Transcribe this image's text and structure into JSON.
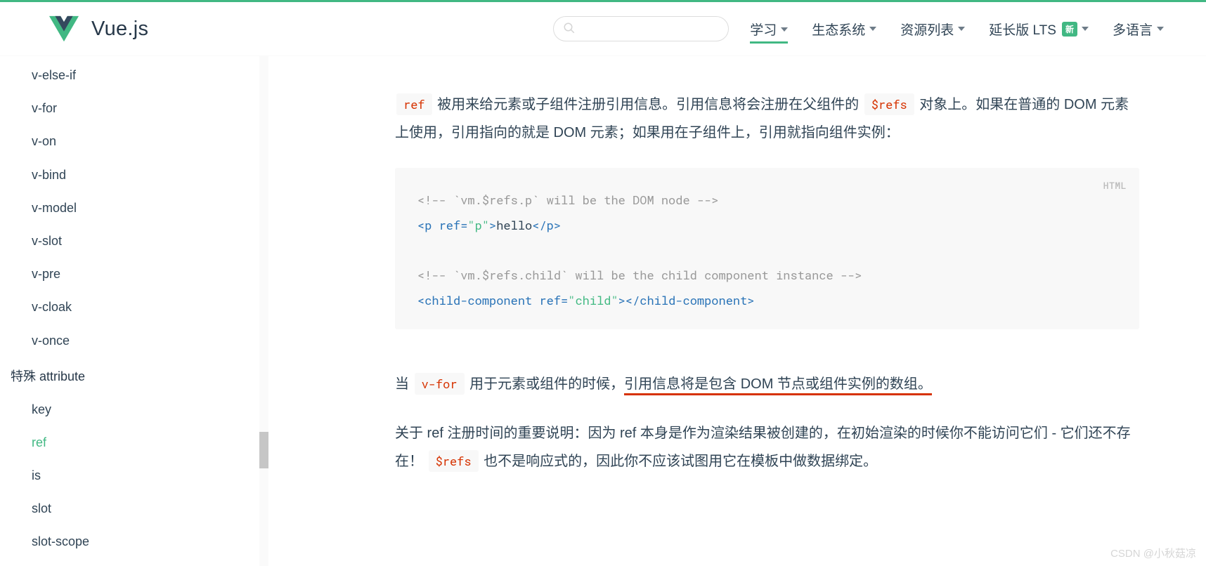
{
  "header": {
    "brand": "Vue.js",
    "nav": [
      {
        "label": "学习",
        "active": true,
        "caret": true
      },
      {
        "label": "生态系统",
        "caret": true
      },
      {
        "label": "资源列表",
        "caret": true
      },
      {
        "label": "延长版 LTS",
        "badge": "新",
        "caret": true
      },
      {
        "label": "多语言",
        "caret": true
      }
    ]
  },
  "sidebar": {
    "items1": [
      "v-else-if",
      "v-for",
      "v-on",
      "v-bind",
      "v-model",
      "v-slot",
      "v-pre",
      "v-cloak",
      "v-once"
    ],
    "heading": "特殊 attribute",
    "items2": [
      "key",
      "ref",
      "is",
      "slot",
      "slot-scope"
    ],
    "selected": "ref"
  },
  "content": {
    "p1_a": "ref",
    "p1_b": " 被用来给元素或子组件注册引用信息。引用信息将会注册在父组件的 ",
    "p1_c": "$refs",
    "p1_d": " 对象上。如果在普通的 DOM 元素上使用，引用指向的就是 DOM 元素；如果用在子组件上，引用就指向组件实例：",
    "code": {
      "lang": "HTML",
      "l1": "<!-- `vm.$refs.p` will be the DOM node -->",
      "l2_a": "<p",
      "l2_b": " ref",
      "l2_c": "=",
      "l2_d": "\"p\"",
      "l2_e": ">",
      "l2_f": "hello",
      "l2_g": "</p>",
      "l3": "<!-- `vm.$refs.child` will be the child component instance -->",
      "l4_a": "<child-component",
      "l4_b": " ref",
      "l4_c": "=",
      "l4_d": "\"child\"",
      "l4_e": ">",
      "l4_f": "</child-component>"
    },
    "p2_a": "当 ",
    "p2_b": "v-for",
    "p2_c": " 用于元素或组件的时候，",
    "p2_d": "引用信息将是包含 DOM 节点或组件实例的数组。",
    "p3_a": "关于 ref 注册时间的重要说明：因为 ref 本身是作为渲染结果被创建的，在初始渲染的时候你不能访问它们 - 它们还不存在！ ",
    "p3_b": "$refs",
    "p3_c": " 也不是响应式的，因此你不应该试图用它在模板中做数据绑定。"
  },
  "watermark": "CSDN @小秋菇凉"
}
